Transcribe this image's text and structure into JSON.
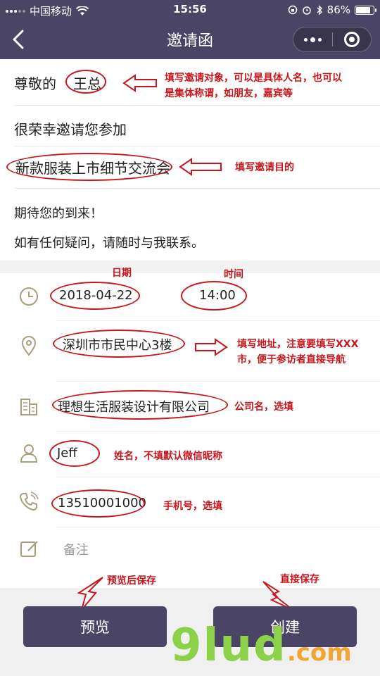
{
  "status_bar": {
    "carrier": "中国移动",
    "time": "15:56",
    "battery_text": "86%",
    "battery_level": 0.86
  },
  "nav": {
    "title": "邀请函",
    "back_icon": "chevron-left-icon",
    "more_icon": "more-dots-icon",
    "close_icon": "capsule-close-icon"
  },
  "letter": {
    "greeting_prefix": "尊敬的",
    "recipient": "王总",
    "honored_line": "很荣幸邀请您参加",
    "event_name": "新款服装上市细节交流会",
    "closing_1": "期待您的到来！",
    "closing_2": "如有任何疑问，请随时与我联系。"
  },
  "form": {
    "date": "2018-04-22",
    "time": "14:00",
    "address": "深圳市市民中心3楼",
    "company": "理想生活服装设计有限公司",
    "name": "Jeff",
    "phone": "13510001000",
    "note_placeholder": "备注"
  },
  "annotations": {
    "recipient_note_1": "填写邀请对象，可以是具体人名，也可以",
    "recipient_note_2": "是集体称谓，如朋友，嘉宾等",
    "purpose_note": "填写邀请目的",
    "date_label": "日期",
    "time_label": "时间",
    "address_note_1": "填写地址，注意要填写XXX",
    "address_note_2": "市，便于参访者直接导航",
    "company_note": "公司名，选填",
    "name_note": "姓名，不填默认微信昵称",
    "phone_note": "手机号，选填",
    "preview_note": "预览后保存",
    "create_note": "直接保存"
  },
  "buttons": {
    "preview": "预览",
    "create": "创建"
  },
  "watermark": {
    "brand": "9lud",
    "suffix": ".com"
  },
  "colors": {
    "theme": "#4a4566",
    "annotation": "#c8161d",
    "watermark_green": "#8bd24a",
    "watermark_orange": "#f3a531"
  }
}
